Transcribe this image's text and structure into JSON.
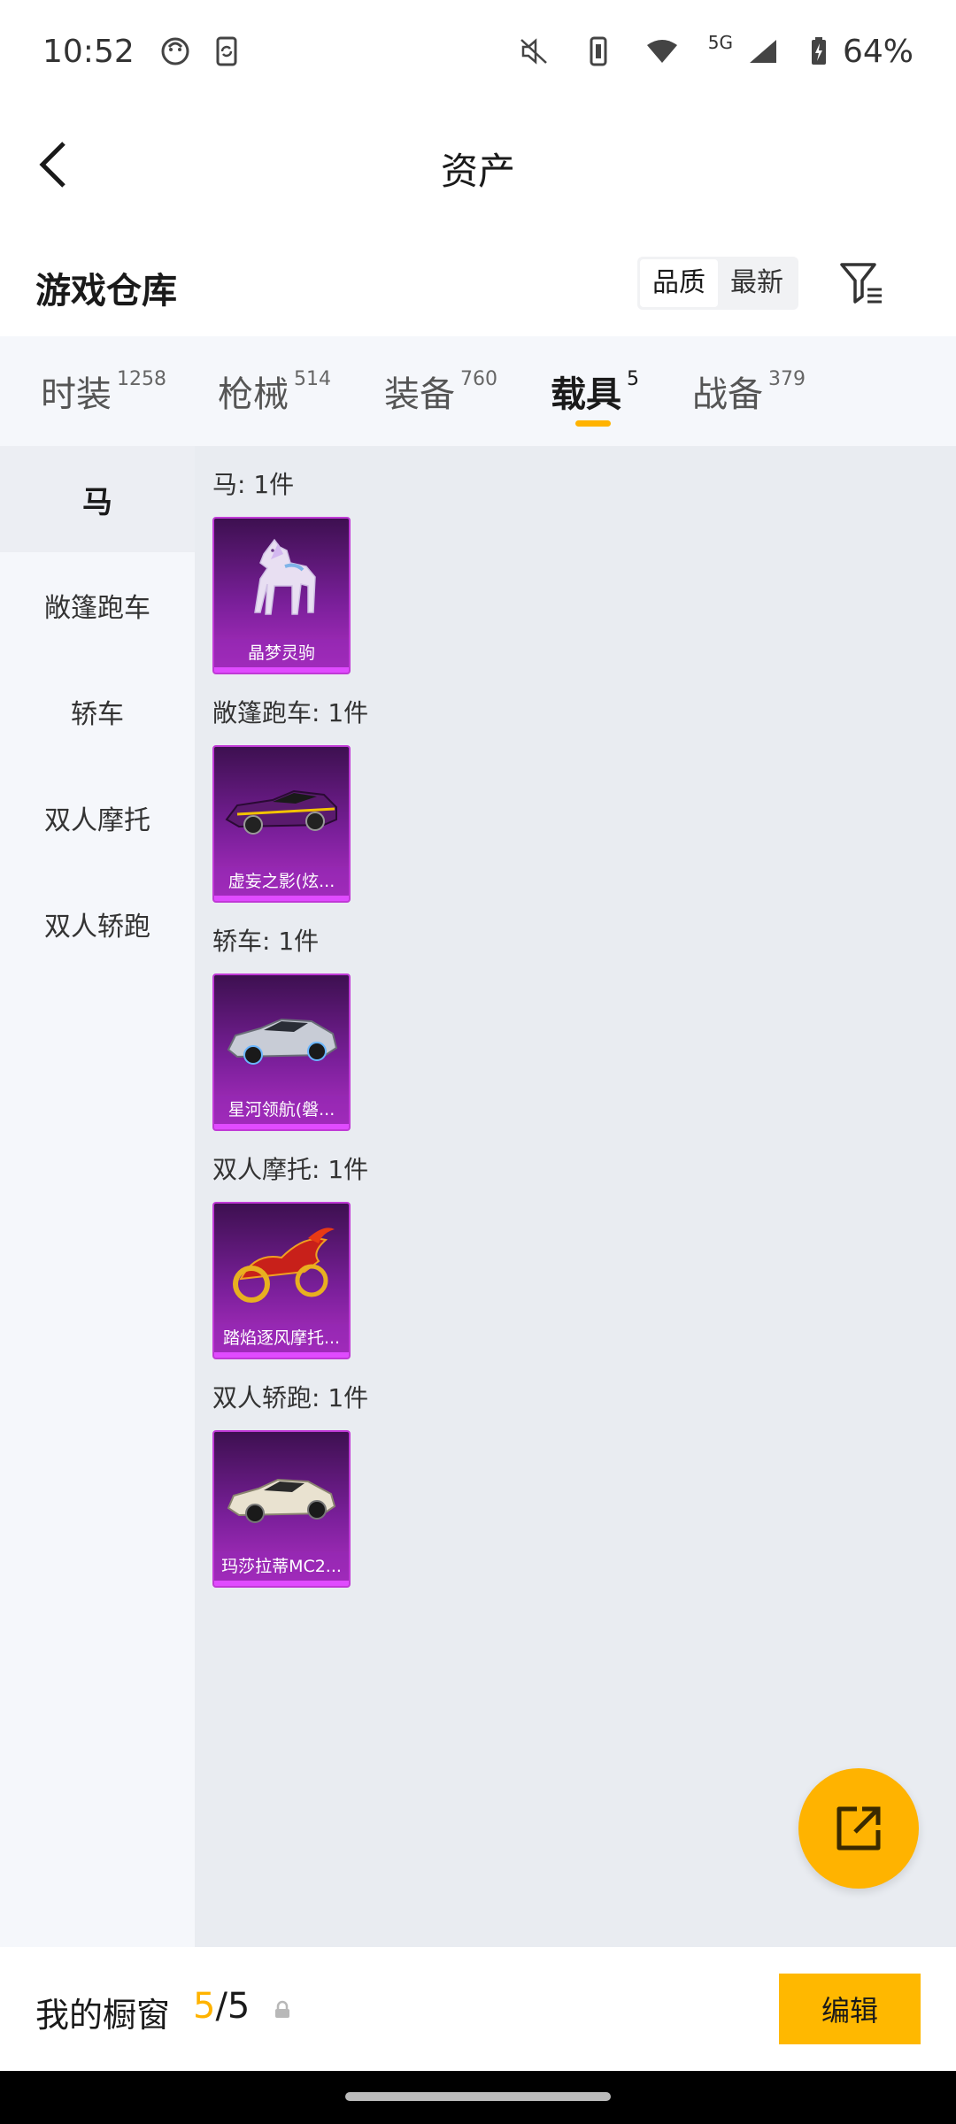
{
  "status_bar": {
    "time": "10:52",
    "battery": "64%",
    "network": "5G",
    "icons": [
      "emoji-face-icon",
      "phone-sync-icon",
      "mute-icon",
      "vibrate-icon",
      "wifi-icon",
      "signal-icon",
      "battery-charging-icon"
    ]
  },
  "header": {
    "title": "资产",
    "back_icon": "chevron-left-icon"
  },
  "warehouse": {
    "title": "游戏仓库",
    "sort_options": [
      "品质",
      "最新"
    ],
    "sort_selected": "品质",
    "filter_icon": "filter-icon"
  },
  "tabs": [
    {
      "label": "时装",
      "count": "1258"
    },
    {
      "label": "枪械",
      "count": "514"
    },
    {
      "label": "装备",
      "count": "760"
    },
    {
      "label": "载具",
      "count": "5"
    },
    {
      "label": "战备",
      "count": "379"
    }
  ],
  "active_tab": "载具",
  "side_nav": [
    "马",
    "敞篷跑车",
    "轿车",
    "双人摩托",
    "双人轿跑"
  ],
  "side_nav_active": "马",
  "groups": [
    {
      "label": "马: 1件",
      "item": "晶梦灵驹"
    },
    {
      "label": "敞篷跑车: 1件",
      "item": "虚妄之影(炫..."
    },
    {
      "label": "轿车: 1件",
      "item": "星河领航(磐..."
    },
    {
      "label": "双人摩托: 1件",
      "item": "踏焰逐风摩托..."
    },
    {
      "label": "双人轿跑: 1件",
      "item": "玛莎拉蒂MC2..."
    }
  ],
  "fab_icon": "share-external-icon",
  "bottom_bar": {
    "label": "我的橱窗",
    "current": "5",
    "total": "/5",
    "lock_icon": "lock-icon",
    "edit_label": "编辑"
  },
  "colors": {
    "accent": "#ffb300",
    "card_purple": "#7a1f9a"
  }
}
